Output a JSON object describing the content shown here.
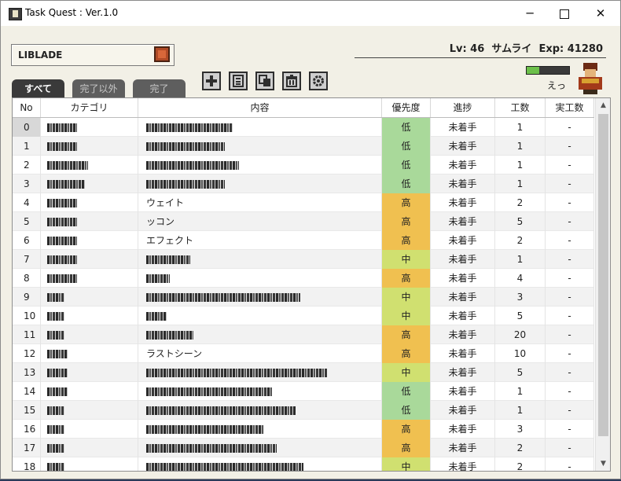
{
  "window": {
    "title": "Task Quest : Ver.1.0",
    "minimize": "─",
    "close": "✕"
  },
  "project": {
    "name": "LIBLADE",
    "icon": "book-icon"
  },
  "player": {
    "stats": "Lv: 46  サムライ  Exp: 41280",
    "status": "えっ",
    "hp_fraction": 0.3
  },
  "tabs": [
    {
      "label": "すべて"
    },
    {
      "label": "完了以外"
    },
    {
      "label": "完了"
    }
  ],
  "toolbar": [
    {
      "icon": "add-icon"
    },
    {
      "icon": "detail-icon"
    },
    {
      "icon": "copy-icon"
    },
    {
      "icon": "trash-icon"
    },
    {
      "icon": "gear-icon"
    }
  ],
  "table": {
    "headers": [
      "No",
      "カテゴリ",
      "内容",
      "優先度",
      "進捗",
      "工数",
      "実工数"
    ],
    "rows": [
      {
        "no": "0",
        "priority": "低",
        "progress": "未着手",
        "work": "1",
        "actual": "-"
      },
      {
        "no": "1",
        "priority": "低",
        "progress": "未着手",
        "work": "1",
        "actual": "-"
      },
      {
        "no": "2",
        "priority": "低",
        "progress": "未着手",
        "work": "1",
        "actual": "-"
      },
      {
        "no": "3",
        "priority": "低",
        "progress": "未着手",
        "work": "1",
        "actual": "-"
      },
      {
        "no": "4",
        "priority": "高",
        "content": "ウェイト",
        "progress": "未着手",
        "work": "2",
        "actual": "-"
      },
      {
        "no": "5",
        "priority": "高",
        "content": "ッコン",
        "progress": "未着手",
        "work": "5",
        "actual": "-"
      },
      {
        "no": "6",
        "priority": "高",
        "content": "エフェクト",
        "progress": "未着手",
        "work": "2",
        "actual": "-"
      },
      {
        "no": "7",
        "priority": "中",
        "progress": "未着手",
        "work": "1",
        "actual": "-"
      },
      {
        "no": "8",
        "priority": "高",
        "progress": "未着手",
        "work": "4",
        "actual": "-"
      },
      {
        "no": "9",
        "priority": "中",
        "progress": "未着手",
        "work": "3",
        "actual": "-"
      },
      {
        "no": "10",
        "priority": "中",
        "progress": "未着手",
        "work": "5",
        "actual": "-"
      },
      {
        "no": "11",
        "priority": "高",
        "progress": "未着手",
        "work": "20",
        "actual": "-"
      },
      {
        "no": "12",
        "priority": "高",
        "content": "ラストシーン",
        "progress": "未着手",
        "work": "10",
        "actual": "-"
      },
      {
        "no": "13",
        "priority": "中",
        "progress": "未着手",
        "work": "5",
        "actual": "-"
      },
      {
        "no": "14",
        "priority": "低",
        "progress": "未着手",
        "work": "1",
        "actual": "-"
      },
      {
        "no": "15",
        "priority": "低",
        "progress": "未着手",
        "work": "1",
        "actual": "-"
      },
      {
        "no": "16",
        "priority": "高",
        "progress": "未着手",
        "work": "3",
        "actual": "-"
      },
      {
        "no": "17",
        "priority": "高",
        "progress": "未着手",
        "work": "2",
        "actual": "-"
      },
      {
        "no": "18",
        "priority": "中",
        "progress": "未着手",
        "work": "2",
        "actual": "-"
      }
    ]
  },
  "colors": {
    "priority_low": "#a9d99a",
    "priority_mid": "#d0e070",
    "priority_high": "#f0c050"
  }
}
